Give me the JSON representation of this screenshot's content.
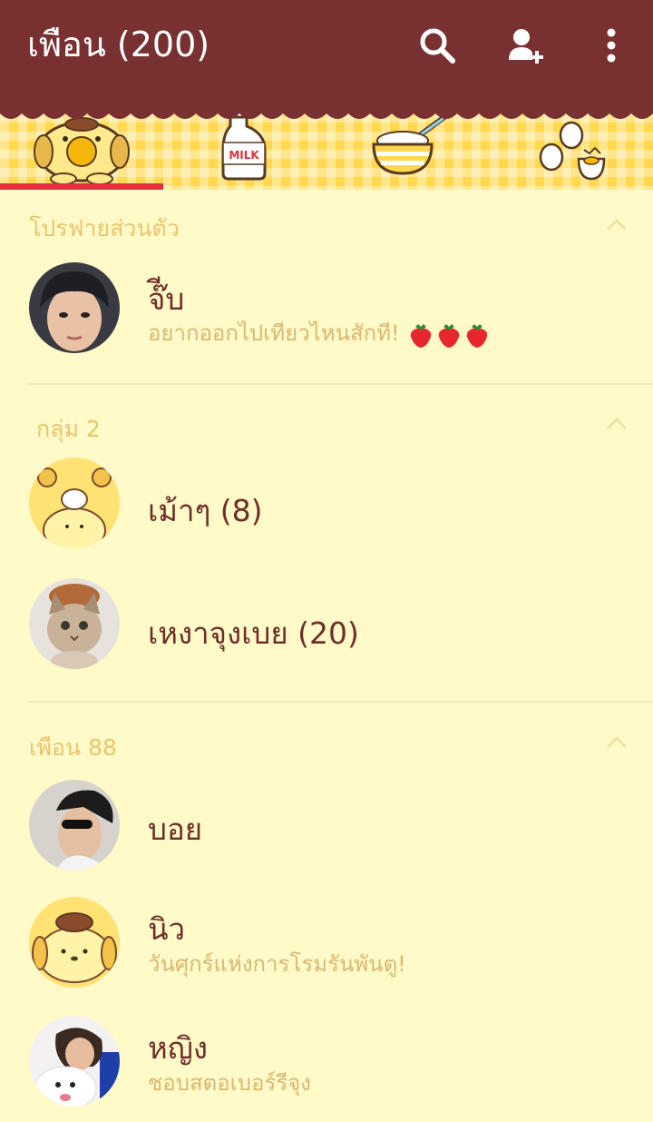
{
  "header": {
    "title": "เพือน (200)",
    "icons": [
      "search-icon",
      "add-friend-icon",
      "more-vertical-icon"
    ]
  },
  "tabs": [
    {
      "icon": "pompompurin-tab-icon",
      "selected": true
    },
    {
      "icon": "milk-bottle-tab-icon",
      "selected": false,
      "label": "MILK"
    },
    {
      "icon": "bowl-tab-icon",
      "selected": false
    },
    {
      "icon": "eggs-tab-icon",
      "selected": false
    }
  ],
  "sections": {
    "profile": {
      "title": "โปรฟายส่วนตัว"
    },
    "groups": {
      "title": "กลุ่ม 2"
    },
    "friends": {
      "title": "เพือน 88"
    }
  },
  "profile": {
    "name": "จ๊ีบ",
    "status": "อยากออกไปเทียวไหนสักที!"
  },
  "groups": [
    {
      "name": "เม้าๆ (8)"
    },
    {
      "name": "เหงาจุงเบย (20)"
    }
  ],
  "friends": [
    {
      "name": "บอย"
    },
    {
      "name": "นิว",
      "status": "วันศุกร์แห่งการโรมรันพันตู!"
    },
    {
      "name": "หญิง",
      "status": "ชอบสตอเบอร์รีจุง"
    }
  ],
  "colors": {
    "header_bg": "#783030",
    "list_bg": "#FFFAC8",
    "tab_bg": "#FFD84E",
    "indicator": "#E0303C",
    "name_text": "#6E2E28",
    "secondary_text": "#D9B873"
  }
}
